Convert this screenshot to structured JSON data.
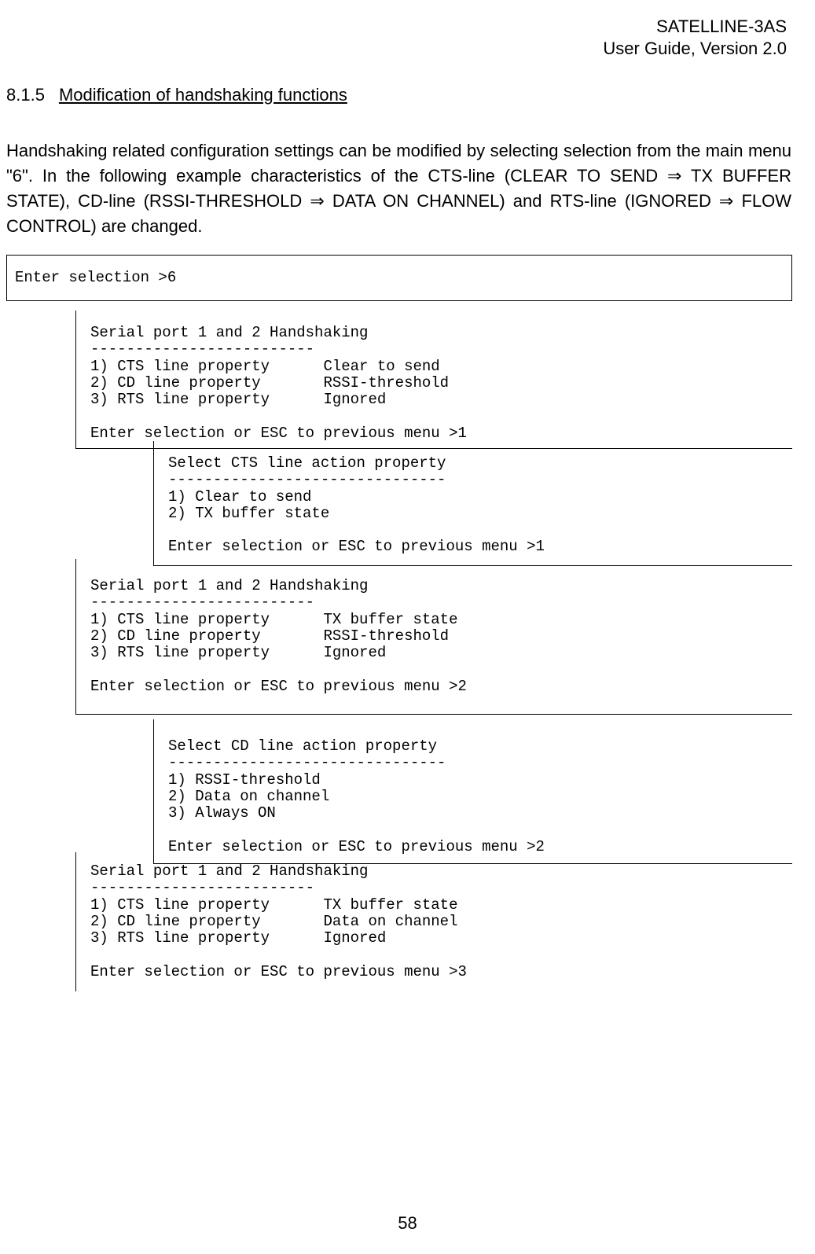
{
  "header": {
    "product": "SATELLINE-3AS",
    "guide": "User Guide, Version 2.0"
  },
  "section": {
    "number": "8.1.5",
    "title": "Modification of handshaking functions"
  },
  "intro": {
    "text": "Handshaking related configuration settings can be modified by selecting selection from the main menu \"6\". In the following example characteristics of the CTS-line (CLEAR TO SEND ⇒ TX BUFFER STATE), CD-line (RSSI-THRESHOLD ⇒ DATA ON CHANNEL) and RTS-line (IGNORED ⇒ FLOW CONTROL) are changed."
  },
  "box1": {
    "content": "Enter selection >6"
  },
  "box2": {
    "content": "Serial port 1 and 2 Handshaking\n-------------------------\n1) CTS line property      Clear to send\n2) CD line property       RSSI-threshold\n3) RTS line property      Ignored\n\nEnter selection or ESC to previous menu >1"
  },
  "box3": {
    "content": "Select CTS line action property\n-------------------------------\n1) Clear to send\n2) TX buffer state\n\nEnter selection or ESC to previous menu >1"
  },
  "box4": {
    "content": "Serial port 1 and 2 Handshaking\n-------------------------\n1) CTS line property      TX buffer state\n2) CD line property       RSSI-threshold\n3) RTS line property      Ignored\n\nEnter selection or ESC to previous menu >2"
  },
  "box5": {
    "content": "Select CD line action property\n-------------------------------\n1) RSSI-threshold\n2) Data on channel\n3) Always ON\n\nEnter selection or ESC to previous menu >2"
  },
  "box6": {
    "content": "Serial port 1 and 2 Handshaking\n-------------------------\n1) CTS line property      TX buffer state\n2) CD line property       Data on channel\n3) RTS line property      Ignored\n\nEnter selection or ESC to previous menu >3"
  },
  "page_number": "58"
}
